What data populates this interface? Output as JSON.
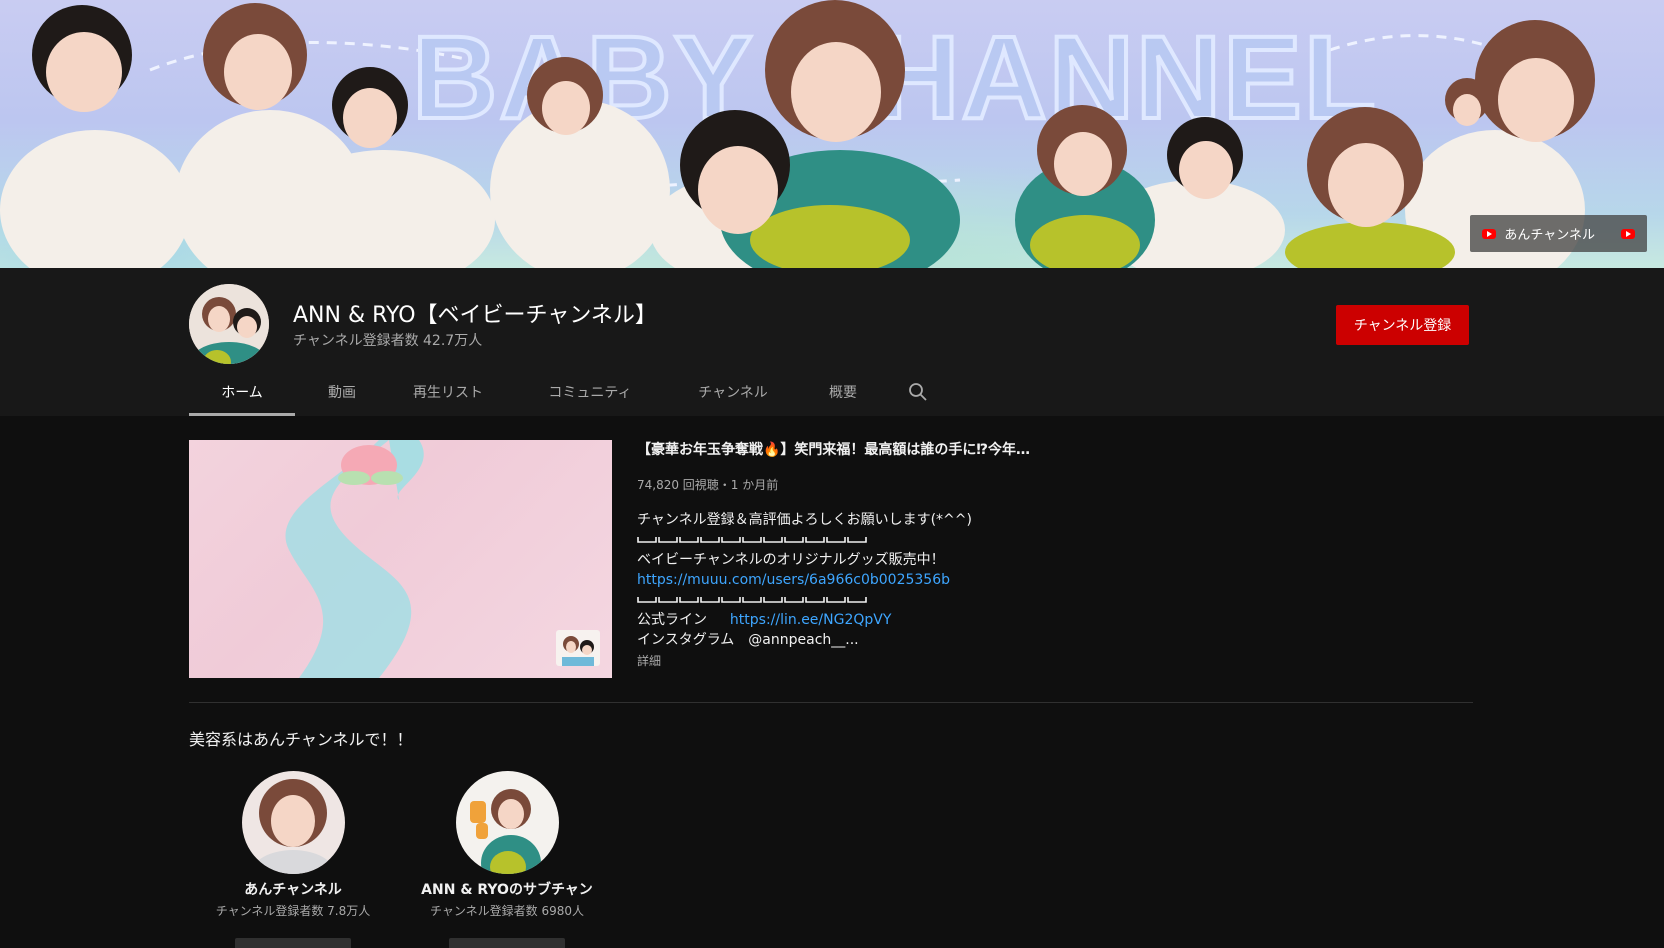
{
  "banner": {
    "text": "BABY CHANNEL",
    "chip_label": "あんチャンネル",
    "chip_icon": "youtube-icon"
  },
  "channel": {
    "name": "ANN & RYO【ベイビーチャンネル】",
    "subscribers": "チャンネル登録者数 42.7万人",
    "subscribe_label": "チャンネル登録"
  },
  "tabs": [
    {
      "label": "ホーム",
      "active": true
    },
    {
      "label": "動画",
      "active": false
    },
    {
      "label": "再生リスト",
      "active": false
    },
    {
      "label": "コミュニティ",
      "active": false
    },
    {
      "label": "チャンネル",
      "active": false
    },
    {
      "label": "概要",
      "active": false
    }
  ],
  "search_icon": "search-icon",
  "featured_video": {
    "title": "【豪華お年玉争奪戦🔥】笑門来福！最高額は誰の手に⁉今年…",
    "meta": "74,820 回視聴・1 か月前",
    "desc_1": "チャンネル登録＆高評価よろしくお願いします(*^^)",
    "dash_pattern": "﹌",
    "desc_2": "ベイビーチャンネルのオリジナルグッズ販売中！",
    "link_1": "https://muuu.com/users/6a966c0b0025356b",
    "desc_line_label": "公式ライン",
    "link_2": "https://lin.ee/NG2QpVY",
    "desc_insta": "インスタグラム　@annpeach__...",
    "more": "詳細"
  },
  "featured_channels": {
    "title": "美容系はあんチャンネルで！！",
    "items": [
      {
        "name": "あんチャンネル",
        "subscribers": "チャンネル登録者数 7.8万人"
      },
      {
        "name": "ANN & RYOのサブチャン",
        "subscribers": "チャンネル登録者数 6980人"
      }
    ]
  },
  "colors": {
    "background": "#0f0f0f",
    "header": "#181818",
    "subscribe": "#cc0000",
    "link": "#3ea6ff"
  }
}
